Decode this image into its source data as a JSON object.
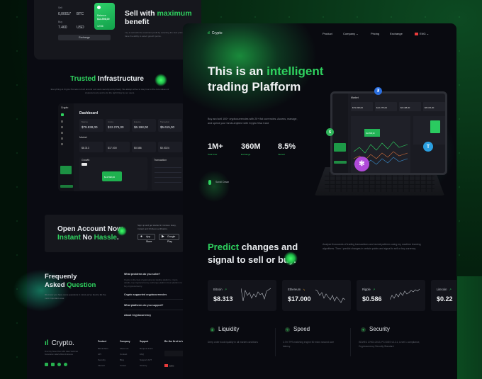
{
  "colors": {
    "accent": "#2fd25f",
    "background": "#090a10",
    "card": "#13141b"
  },
  "back_page": {
    "exchange_widget": {
      "sell_label": "Sell",
      "sell_amount": "0,00017",
      "sell_currency": "BTC",
      "buy_label": "Buy",
      "buy_amount": "7.460",
      "buy_currency": "USD",
      "card_label": "Balance",
      "card_amount": "$14.598,00",
      "card_exp": "12/36",
      "exchange_button": "Exchange"
    },
    "sell_section": {
      "title_a": "Sell with ",
      "title_highlight": "maximum",
      "title_b": "benefit",
      "description": "I try to sell with the maximum profit by selecting the best price conditions. I have the ability to select growth points."
    },
    "trusted": {
      "title_highlight": "Trusted",
      "title_rest": " Infrastructure",
      "description": "Everything at Crypto Pumeko is built around our users security and privacy. We always strive to stay true to the core values of cryptocurrency and to do the right thing by our users."
    },
    "dashboard_preview": {
      "logo": "Crypto",
      "title": "Dashboard",
      "stats": [
        "$79.938,00",
        "$12.275,00",
        "$6.198,00",
        "$5.615,00"
      ],
      "market_label": "Market",
      "markets": [
        "$8.313",
        "$17.000",
        "$0.586",
        "$0.0024"
      ],
      "growth_label": "Growth",
      "transactions_label": "Transaction",
      "growth_value": "$14.598,00"
    },
    "open_account": {
      "line1": "Open Account Now.",
      "line2_a": "Instant",
      "line2_b": " No ",
      "line2_c": "Hassle",
      "line2_d": ".",
      "description": "Sign up and get started in minutes. Easy, Instant and Frictless verification.",
      "app_store": "App Store",
      "google_play": "Google Play"
    },
    "faq": {
      "title_a": "Frequenly",
      "title_b": "Asked ",
      "title_highlight": "Question",
      "description": "We know you have some questions in mind, we've tried to list the most important ones.",
      "items": [
        {
          "q": "What problems do you solve?",
          "a": "Crypto is the best cryptocurrency trading platform, crypto details, top cryptocurrency exchange platform best platform to buy cryptocurrency."
        },
        {
          "q": "Crypto supported cryptocurrencies"
        },
        {
          "q": "What platforms do you support?"
        },
        {
          "q": "About Cryptocurrency"
        }
      ]
    },
    "footer": {
      "logo": "Crypto.",
      "address": "Fine City Tower Floor 18th Jalan Sudirman Kecamatan Jakarta Barat Indonesia",
      "social_icons": [
        "linkedin-icon",
        "instagram-icon",
        "facebook-icon",
        "other-icon"
      ],
      "columns": [
        {
          "title": "Product",
          "items": [
            "Blockchain",
            "API",
            "Security",
            "Interest"
          ]
        },
        {
          "title": "Company",
          "items": [
            "About Us",
            "Contact",
            "Blog",
            "Career"
          ]
        },
        {
          "title": "Support",
          "items": [
            "Request Form",
            "FAQ",
            "Support 24/7",
            "Glosary"
          ]
        }
      ],
      "newsletter_title": "Be the first to know Crypto news",
      "newsletter_placeholder": "Your email",
      "language": "ENG"
    }
  },
  "main_page": {
    "nav": {
      "logo": "Crypto",
      "items": [
        "Product",
        "Company",
        "Pricing",
        "Exchange"
      ],
      "language": "ENG"
    },
    "hero": {
      "title_a": "This is an ",
      "title_highlight": "intelligent",
      "title_b": "trading Plafform",
      "description": "Buy and sell 100+ cryptocurrencies with 20+ fiat currencies. Access, manage, and spend your funds anytime with Crypto Visa Card",
      "kpis": [
        {
          "value": "1M+",
          "label": "Total User"
        },
        {
          "value": "360M",
          "label": "Exchange"
        },
        {
          "value": "8.5%",
          "label": "Interest"
        }
      ],
      "scroll_label": "Scroll Down"
    },
    "tablet_preview": {
      "title": "Market",
      "stats": [
        "$79.938,00",
        "$12.275,00",
        "$6.198,00",
        "$5.615,00"
      ],
      "growth_value": "$14.598,00"
    },
    "predict": {
      "title_highlight": "Predict",
      "title_a": " changes and",
      "title_b": "signal to sell or buy.",
      "description": "Analyze thousands of trading transactions and reveal patterns using my machine learning algorithms. Then I predict changes in certain points and signal to sell or buy currency."
    },
    "tickers": [
      {
        "name": "Bitcoin",
        "price": "$8.313",
        "trend": "up",
        "trend_color": "#2fd25f"
      },
      {
        "name": "Ethereum",
        "price": "$17.000",
        "trend": "down",
        "trend_color": "#e0a431"
      },
      {
        "name": "Ripple",
        "price": "$0.586",
        "trend": "up",
        "trend_color": "#2fd25f"
      },
      {
        "name": "Litecoin",
        "price": "$0.22",
        "trend": "up",
        "trend_color": "#2fd25f"
      }
    ],
    "features": [
      {
        "icon": "dollar-icon",
        "title": "Liquidity",
        "description": "Deep order book liquidity in all market conditions"
      },
      {
        "icon": "lightning-icon",
        "title": "Speed",
        "description": "2.7m TPS matching engine 50 micro second core latency"
      },
      {
        "icon": "shield-icon",
        "title": "Security",
        "description": "ISO/IEC 27001:2013, PCI DSS v3.2.1, Level 1 compliance, Cryptocurrency Security Standard"
      }
    ]
  }
}
